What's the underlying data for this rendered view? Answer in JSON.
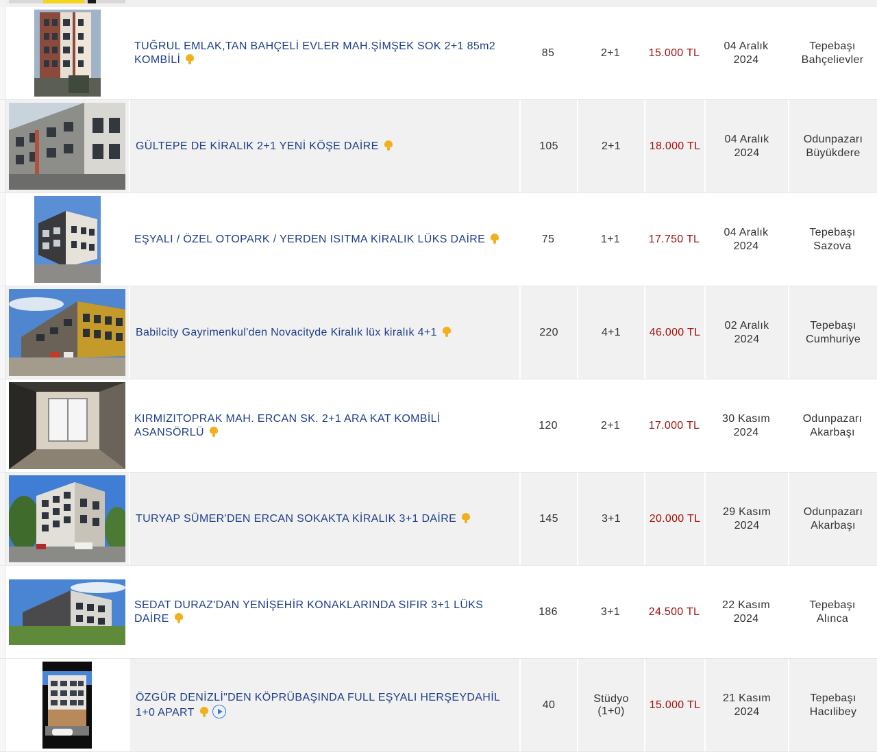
{
  "listings": [
    {
      "title": "TUĞRUL EMLAK,TAN BAHÇELİ EVLER MAH.ŞİMŞEK SOK 2+1 85m2 KOMBİLİ",
      "m2": "85",
      "rooms": "2+1",
      "rooms2": "",
      "price": "15.000 TL",
      "date1": "04 Aralık",
      "date2": "2024",
      "loc1": "Tepebaşı",
      "loc2": "Bahçelievler",
      "photo": "brick-building-photo",
      "video": false
    },
    {
      "title": "GÜLTEPE DE KİRALIK 2+1 YENİ KÖŞE DAİRE",
      "m2": "105",
      "rooms": "2+1",
      "rooms2": "",
      "price": "18.000 TL",
      "date1": "04 Aralık",
      "date2": "2024",
      "loc1": "Odunpazarı",
      "loc2": "Büyükdere",
      "photo": "gray-building-photo",
      "video": false
    },
    {
      "title": "EŞYALI / ÖZEL OTOPARK / YERDEN ISITMA KİRALIK LÜKS DAİRE",
      "m2": "75",
      "rooms": "1+1",
      "rooms2": "",
      "price": "17.750 TL",
      "date1": "04 Aralık",
      "date2": "2024",
      "loc1": "Tepebaşı",
      "loc2": "Sazova",
      "photo": "corner-building-photo",
      "video": false
    },
    {
      "title": "Babilcity Gayrimenkul'den Novacityde Kiralık lüx kiralık 4+1",
      "m2": "220",
      "rooms": "4+1",
      "rooms2": "",
      "price": "46.000 TL",
      "date1": "02 Aralık",
      "date2": "2024",
      "loc1": "Tepebaşı",
      "loc2": "Cumhuriye",
      "photo": "complex-building-photo",
      "video": false
    },
    {
      "title": "KIRMIZITOPRAK MAH. ERCAN SK. 2+1 ARA KAT KOMBİLİ ASANSÖRLÜ",
      "m2": "120",
      "rooms": "2+1",
      "rooms2": "",
      "price": "17.000 TL",
      "date1": "30 Kasım",
      "date2": "2024",
      "loc1": "Odunpazarı",
      "loc2": "Akarbaşı",
      "photo": "empty-room-photo",
      "video": false
    },
    {
      "title": "TURYAP SÜMER'DEN ERCAN SOKAKTA KİRALIK 3+1 DAİRE",
      "m2": "145",
      "rooms": "3+1",
      "rooms2": "",
      "price": "20.000 TL",
      "date1": "29 Kasım",
      "date2": "2024",
      "loc1": "Odunpazarı",
      "loc2": "Akarbaşı",
      "photo": "street-building-photo",
      "video": false
    },
    {
      "title": "SEDAT DURAZ'DAN YENİŞEHİR KONAKLARINDA SIFIR 3+1 LÜKS DAİRE",
      "m2": "186",
      "rooms": "3+1",
      "rooms2": "",
      "price": "24.500 TL",
      "date1": "22 Kasım",
      "date2": "2024",
      "loc1": "Tepebaşı",
      "loc2": "Alınca",
      "photo": "panorama-building-photo",
      "video": false
    },
    {
      "title": "ÖZGÜR DENİZLİ\"DEN KÖPRÜBAŞINDA FULL EŞYALI HERŞEYDAHİL 1+0 APART",
      "m2": "40",
      "rooms": "Stüdyo",
      "rooms2": "(1+0)",
      "price": "15.000 TL",
      "date1": "21 Kasım",
      "date2": "2024",
      "loc1": "Tepebaşı",
      "loc2": "Hacılibey",
      "photo": "narrow-building-photo",
      "video": true
    }
  ],
  "colors": {
    "price": "#a3110f",
    "title_link": "#1e3f8a",
    "badge": "#f2b01e",
    "video": "#2b7de0"
  }
}
